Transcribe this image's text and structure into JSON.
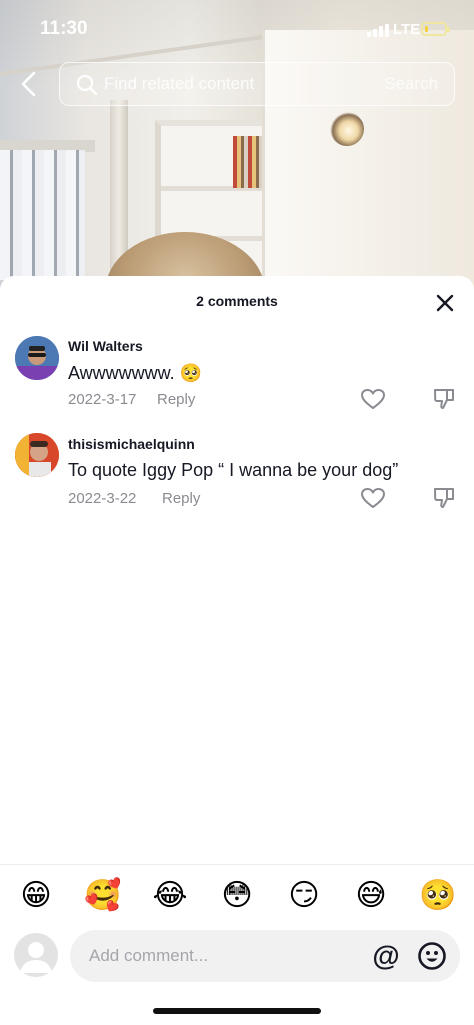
{
  "status_bar": {
    "time": "11:30",
    "network": "LTE",
    "battery_level": 0.15,
    "battery_color": "#f3d23c"
  },
  "search": {
    "placeholder": "Find related content",
    "button_label": "Search",
    "back_icon": "chevron-left-icon",
    "search_icon": "magnifier-icon"
  },
  "comments_panel": {
    "title": "2 comments",
    "close_icon": "close-icon",
    "comments": [
      {
        "username": "Wil Walters",
        "text": "Awwwwwww. 🥺",
        "date": "2022-3-17",
        "reply_label": "Reply",
        "like_icon": "heart-outline-icon",
        "dislike_icon": "thumbs-down-icon"
      },
      {
        "username": "thisismichaelquinn",
        "text": "To quote Iggy Pop “ I wanna be your dog”",
        "date": "2022-3-22",
        "reply_label": "Reply",
        "like_icon": "heart-outline-icon",
        "dislike_icon": "thumbs-down-icon"
      }
    ]
  },
  "emoji_bar": [
    "😁",
    "🥰",
    "😂",
    "😳",
    "😏",
    "😅",
    "🥺"
  ],
  "composer": {
    "placeholder": "Add comment...",
    "mention_symbol": "@",
    "emoji_icon": "smiley-face-icon"
  },
  "colors": {
    "text_primary": "#161823",
    "text_secondary": "#8a8b91",
    "input_bg": "#f1f1f2"
  }
}
